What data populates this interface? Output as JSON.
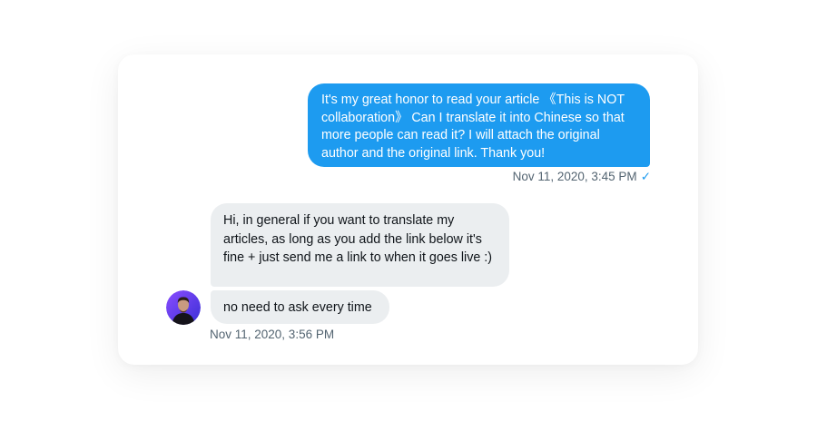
{
  "conversation": {
    "outgoing": {
      "text": "It's my great honor to read your article 《This is NOT collaboration》 Can I translate it into Chinese so that more people can read it?  I will attach the original author and the original link. Thank you!",
      "timestamp": "Nov 11, 2020, 3:45 PM",
      "status_glyph": "✓"
    },
    "incoming": {
      "messages": [
        {
          "text": "Hi, in general if you want to translate my articles, as long as you add the link below it's fine + just send me a link to when it goes live :)"
        },
        {
          "text": "no need to ask every time"
        }
      ],
      "timestamp": "Nov 11, 2020, 3:56 PM",
      "avatar_icon": "user-avatar"
    }
  },
  "colors": {
    "accent": "#1d9bf0",
    "incoming_bubble": "#ebeef0",
    "meta_text": "#536471",
    "avatar_ring": "#7b3ff2"
  }
}
